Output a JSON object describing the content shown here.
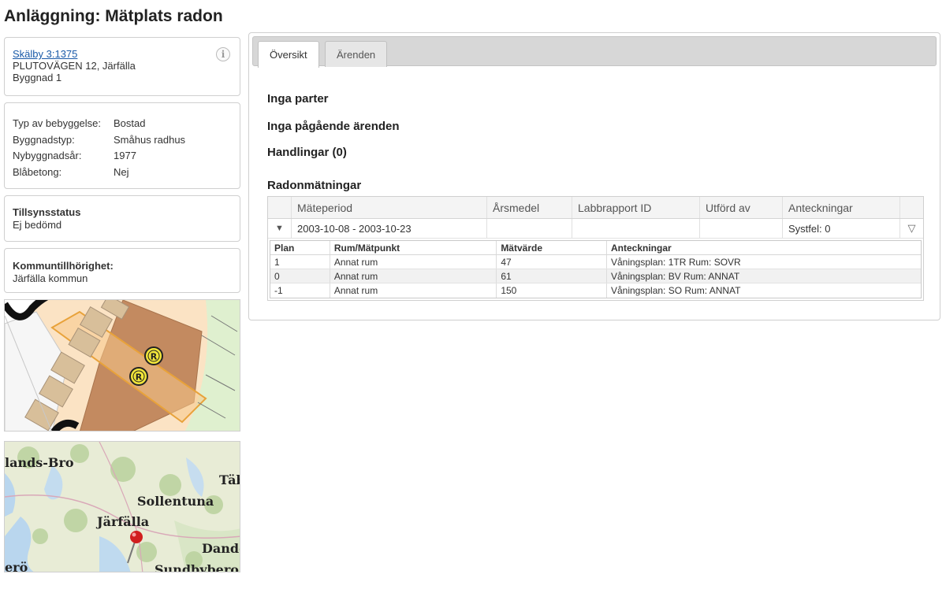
{
  "page": {
    "title": "Anläggning: Mätplats radon"
  },
  "address_card": {
    "property_link": "Skälby 3:1375",
    "street": "PLUTOVÄGEN 12, Järfälla",
    "building": "Byggnad 1",
    "info_icon": "i"
  },
  "properties_card": {
    "rows": [
      {
        "label": "Typ av bebyggelse:",
        "value": "Bostad"
      },
      {
        "label": "Byggnadstyp:",
        "value": "Småhus radhus"
      },
      {
        "label": "Nybyggnadsår:",
        "value": "1977"
      },
      {
        "label": "Blåbetong:",
        "value": "Nej"
      }
    ]
  },
  "status_card": {
    "title": "Tillsynsstatus",
    "value": "Ej bedömd"
  },
  "kommun_card": {
    "title": "Kommuntillhörighet:",
    "value": "Järfälla kommun"
  },
  "detail_map": {
    "marker_label": "R"
  },
  "overview_map": {
    "places": [
      "lands-Bro",
      "Täb",
      "Sollentuna",
      "Järfälla",
      "Dande",
      "erö",
      "Sundbybero"
    ]
  },
  "tabs": [
    {
      "label": "Översikt",
      "active": true
    },
    {
      "label": "Ärenden",
      "active": false
    }
  ],
  "overview": {
    "parter": "Inga parter",
    "arenden": "Inga pågående ärenden",
    "handlingar": "Handlingar (0)",
    "radon_title": "Radonmätningar"
  },
  "radon_grid": {
    "columns": [
      "Mäteperiod",
      "Årsmedel",
      "Labbrapport ID",
      "Utförd av",
      "Anteckningar"
    ],
    "row": {
      "period": "2003-10-08 - 2003-10-23",
      "arsmedel": "",
      "labbrapport": "",
      "utford_av": "",
      "anteckningar": "Systfel: 0"
    },
    "detail": {
      "columns": [
        "Plan",
        "Rum/Mätpunkt",
        "Mätvärde",
        "Anteckningar"
      ],
      "rows": [
        {
          "plan": "1",
          "rum": "Annat rum",
          "varde": "47",
          "ant": "Våningsplan: 1TR Rum: SOVR"
        },
        {
          "plan": "0",
          "rum": "Annat rum",
          "varde": "61",
          "ant": "Våningsplan: BV Rum: ANNAT"
        },
        {
          "plan": "-1",
          "rum": "Annat rum",
          "varde": "150",
          "ant": "Våningsplan: SO Rum: ANNAT"
        }
      ]
    }
  },
  "colors": {
    "link": "#1a5aa8",
    "tab_bar": "#d7d7d7",
    "building_dark": "#c38a60",
    "plot_orange": "#e8a23a",
    "marker_yellow": "#f2e63a",
    "map_pin": "#d11f1f"
  }
}
